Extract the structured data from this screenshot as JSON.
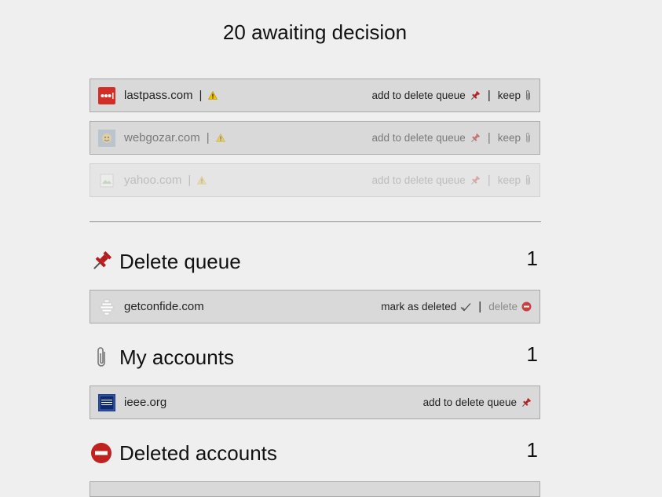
{
  "header": {
    "title": "20 awaiting decision"
  },
  "pending": [
    {
      "domain": "lastpass.com",
      "sep": "|",
      "delete_label": "add to delete queue",
      "bar": "|",
      "keep_label": "keep"
    },
    {
      "domain": "webgozar.com",
      "sep": "|",
      "delete_label": "add to delete queue",
      "bar": "|",
      "keep_label": "keep"
    },
    {
      "domain": "yahoo.com",
      "sep": "|",
      "delete_label": "add to delete queue",
      "bar": "|",
      "keep_label": "keep"
    }
  ],
  "delete_queue": {
    "title": "Delete queue",
    "count": "1",
    "items": [
      {
        "domain": "getconfide.com",
        "mark_label": "mark as deleted",
        "bar": "|",
        "delete_label": "delete"
      }
    ]
  },
  "my_accounts": {
    "title": "My accounts",
    "count": "1",
    "items": [
      {
        "domain": "ieee.org",
        "delete_label": "add to delete queue"
      }
    ]
  },
  "deleted_accounts": {
    "title": "Deleted accounts",
    "count": "1"
  },
  "colors": {
    "pin_red": "#b51e1e",
    "lastpass_red": "#d32d27",
    "warning_yellow": "#f2c200",
    "ieee_blue": "#1a3a8a"
  },
  "icons": [
    "pushpin-icon",
    "paperclip-icon",
    "warning-icon",
    "checkmark-icon",
    "no-entry-icon",
    "lastpass-logo",
    "broken-image-icon",
    "confide-logo",
    "ieee-logo"
  ]
}
